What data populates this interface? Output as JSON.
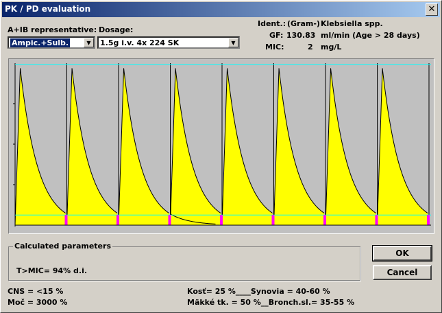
{
  "window": {
    "title": "PK / PD evaluation",
    "close_glyph": "✕"
  },
  "form": {
    "ab_label": "A+IB  representative:",
    "dosage_label": "Dosage:",
    "ab_value": "Ampic.+Sulb.",
    "dosage_value": "1.5g i.v. 4x  224 SK"
  },
  "info": {
    "ident_label": "Ident.:",
    "ident_value": "(Gram-)",
    "organism": "Klebsiella spp.",
    "gf_label": "GF:",
    "gf_value": "130.83",
    "gf_unit": "ml/min (Age > 28 days)",
    "mic_label": "MIC:",
    "mic_value": "2",
    "mic_unit": "mg/L"
  },
  "calc": {
    "title": "Calculated parameters",
    "value": "T>MIC= 94% d.i."
  },
  "buttons": {
    "ok": "OK",
    "cancel": "Cancel"
  },
  "bottom": {
    "cns": "CNS = <15 %",
    "moc": "Moč = 3000 %",
    "kost": "Kosť= 25 %____Synovia = 40-60 %",
    "makke": "Mäkké tk. = 50 %__Bronch.sl.= 35-55 %"
  },
  "chart_data": {
    "type": "area",
    "doses": 8,
    "dosing_interval_h": 6,
    "mic_line": 2,
    "ylim": [
      0,
      32
    ],
    "peak": 31,
    "decay_level_at_next_dose": 2.2,
    "colors": {
      "area": "#ffff00",
      "background": "#c0c0c0",
      "mic_line": "#00ffff",
      "marker": "#ff00ff"
    }
  }
}
